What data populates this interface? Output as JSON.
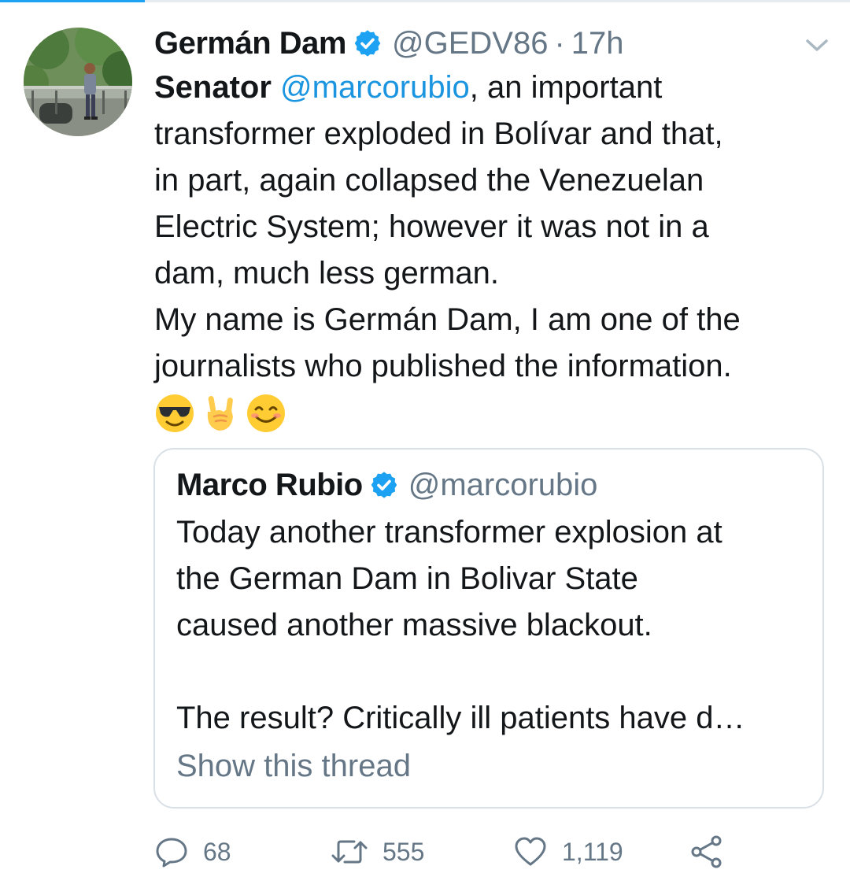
{
  "tweet": {
    "author_name": "Germán Dam",
    "author_handle": "@GEDV86",
    "separator": "·",
    "timestamp": "17h",
    "text_lines": {
      "l1_prefix": "Senator ",
      "l1_mention": "@marcorubio",
      "l1_suffix": ", an important",
      "l2": "transformer exploded in Bolívar and that,",
      "l3": "in part, again collapsed the Venezuelan",
      "l4": "Electric System; however it was not in a",
      "l5": "dam, much less german.",
      "l6": "My name is Germán Dam, I am one of the",
      "l7": "journalists who published the information."
    },
    "emojis": [
      "smiling-face-with-sunglasses",
      "sign-of-the-horns",
      "smiling-face-with-smiling-eyes"
    ]
  },
  "quoted_tweet": {
    "author_name": "Marco Rubio",
    "author_handle": "@marcorubio",
    "text_lines": {
      "l1": "Today another transformer explosion at",
      "l2": "the German Dam in Bolivar State",
      "l3": "caused another massive blackout.",
      "l4": "The result? Critically ill patients have d…"
    },
    "show_thread_label": "Show this thread"
  },
  "actions": {
    "replies": "68",
    "retweets": "555",
    "likes": "1,119"
  },
  "colors": {
    "link_blue": "#1b95e0",
    "verified_blue": "#1da1f2",
    "muted_gray": "#657786",
    "border_gray": "#d9e0e6"
  }
}
